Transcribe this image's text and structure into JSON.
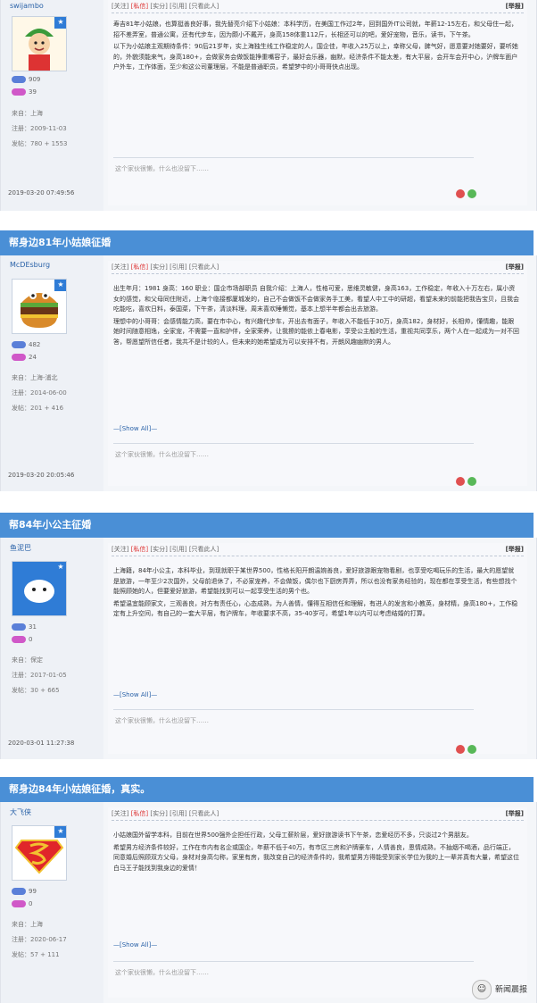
{
  "toolbar": {
    "follow": "[关注]",
    "private_msg": "[私信]",
    "fire": "[实分]",
    "quote": "[引用]",
    "only_author": "[只看此人]",
    "report": "[举报]"
  },
  "signature_placeholder": "这个家伙很懒，什么也没留下……",
  "sig_link": "—[Show All]—",
  "posts": [
    {
      "title": "",
      "username": "swijambo",
      "stat_blue": "909",
      "stat_pink": "39",
      "location": "来自：上海",
      "registered": "注册：2009-11-03",
      "posts_count": "发帖：780 + 1553",
      "time": "2019-03-20 07:49:56",
      "paragraphs": [
        "寿吉81年小姑娘，也算挺善良好事，我先替亮介绍下小姑娘：本科学历，在美国工作过2年，回到国外IT公司就，年薪12-15左右，和父母住一起，招不差弄室，普通公寓，还有代步车，因为颇小不戴开，身高158体重112斤，长相还可以的吧，爱好宠物，音乐，读书，下午茶。",
        "以下为小姑娘主观期待条件：90后21岁年，实上海独生线工作稳定的人，国企佳，年收入25万以上，幸称父母，脾气好，愿意要对她要好，要听她的，外貌须能来气，身高180+，会做家务会做饭能挣重嘴容子，最好会乐器，幽默，经济条件不能太差，有大平层，会开车会开中心，沪牌车面户户外车，工作体面，至少和这公司董理层，不能是普通职员，希望梦中的小哥哥快点出现。"
      ]
    },
    {
      "title": "帮身边81年小姑娘征婚",
      "username": "McDEsburg",
      "stat_blue": "482",
      "stat_pink": "24",
      "location": "来自：上海-浦北",
      "registered": "注册：2014-06-00",
      "posts_count": "发帖：201 + 416",
      "time": "2019-03-20 20:05:46",
      "paragraphs": [
        "出生年月：1981 身高：160 职业：国企市场部职员 自我介绍：上海人，性格可爱，思维灵敏健，身高163，工作稳定，年收入十万左右，属小资女的感觉，和父母同住附近，上海个临接都厦城发的，自己不会做饭不会做家务手工美，看望人中工中的研超，看望未来的前能把我告宝贝，且我会吃能吃，喜欢日料，泰国菜，下午茶，清淡料理，周末喜欢睡懒觉，基本上想半年都会出去旅游。",
        "理想中的小哥哥：会感情能力高，要在市中心，有兴趣代步车，开出去有面子，年收入不能低于30万，身高182，身材好，长相帅，懂情趣，能跟她时间随意相逸，全家宠，不需要一直和护伴，全家荣养，让我擦的能依上春电影，享受公主般的生活，重视共同享乐，两个人在一起成为一对不回答，帮愿望所信任者，我共不是计较的人，但未来的她希望成为可以安排不有，开朗风趣幽默的男人。"
      ]
    },
    {
      "title": "帮84年小公主征婚",
      "username": "鱼泥巴",
      "stat_blue": "31",
      "stat_pink": "0",
      "location": "来自：保定",
      "registered": "注册：2017-01-05",
      "posts_count": "发帖：30 + 665",
      "time": "2020-03-01 11:27:38",
      "paragraphs": [
        "上海籍，84年小公主，本科毕业，到现就职于某世界500，性格长阳开朗温婉善良，爱好旅游跟宠物看剧，也享受吃喝玩乐的生活，最大的愿望就是旅游，一年至少2次国外，父母前退休了，不必家宠养，不会做饭，偶尔也下厨房弄弄，所以也没有家务经验的，现在都在享受生活，有些想找个能照顾她的人，但要爱好旅游，希望能找到可以一起享受生活的男个也。",
        "希望温宜能顾家文，三观善良，对方有责任心，心态成熟，为人善情，懂得互相信任和理解，有进人的发言和小教英，身材精，身高180+，工作稳定有上升空间，有自己的一套大平层，有沪牌车，年收要求不高，35-40岁可，希望1年以内可以考虑结婚的打算。"
      ]
    },
    {
      "title": "帮身边84年小姑娘征婚，真实。",
      "username": "大飞侠",
      "stat_blue": "99",
      "stat_pink": "0",
      "location": "来自：上海",
      "registered": "注册：2020-06-17",
      "posts_count": "发帖：57 + 111",
      "time": "",
      "paragraphs": [
        "小姑娘国外留学本科，目前在世界500强外企担任行政，父母工薪阶层，爱好旅游读书下午茶，恋爱经历不多，只谈过2个男朋友。",
        "希望男方经济条件较好，工作在市内有名企或国企，年薪不低于40万，有市区三房和沪牌豪车，人情善良，恩情成熟，不抽烟不喝酒，品行端正，同意婚后照顾双方父母，身材对身高匀称，家里有房，我改变自己的经济条件的，我希望男方得能受到家长学位为我的上一辈并真有大量，希望这位白马王子能找到我身边的爱情！"
      ]
    }
  ],
  "watermark": "新闻晨报"
}
